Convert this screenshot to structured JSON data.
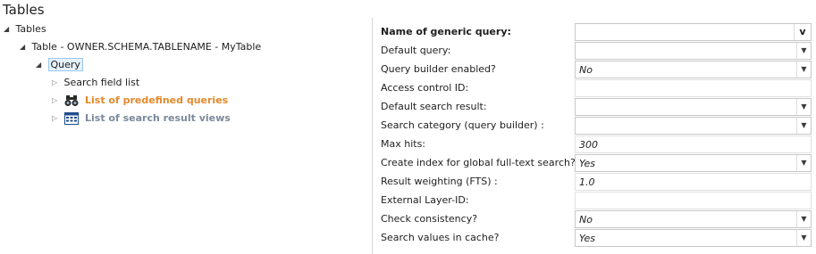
{
  "title": "Tables",
  "tree": {
    "root_label": "Tables",
    "table_label": "Table - OWNER.SCHEMA.TABLENAME - MyTable",
    "query_label": "Query",
    "children": [
      {
        "label": "Search field list",
        "style": "normal",
        "icon": "none"
      },
      {
        "label": "List of predefined queries",
        "style": "orange",
        "icon": "binoculars-icon"
      },
      {
        "label": "List of search result views",
        "style": "grey",
        "icon": "table-view-icon"
      }
    ]
  },
  "form": {
    "rows": [
      {
        "label": "Name of generic query:",
        "value": "",
        "control": "v-button",
        "bold": true
      },
      {
        "label": "Default query:",
        "value": "",
        "control": "dropdown"
      },
      {
        "label": "Query builder enabled?",
        "value": "No",
        "control": "dropdown"
      },
      {
        "label": "Access control ID:",
        "value": "",
        "control": "text"
      },
      {
        "label": "Default search result:",
        "value": "",
        "control": "dropdown"
      },
      {
        "label": "Search category (query builder) :",
        "value": "",
        "control": "dropdown"
      },
      {
        "label": "Max hits:",
        "value": "300",
        "control": "text"
      },
      {
        "label": "Create index for global full-text search?",
        "value": "Yes",
        "control": "dropdown"
      },
      {
        "label": "Result weighting (FTS) :",
        "value": "1.0",
        "control": "text"
      },
      {
        "label": "External Layer-ID:",
        "value": "",
        "control": "text"
      },
      {
        "label": "Check consistency?",
        "value": "No",
        "control": "dropdown"
      },
      {
        "label": "Search values in cache?",
        "value": "Yes",
        "control": "dropdown"
      }
    ],
    "v_button_label": "v"
  }
}
